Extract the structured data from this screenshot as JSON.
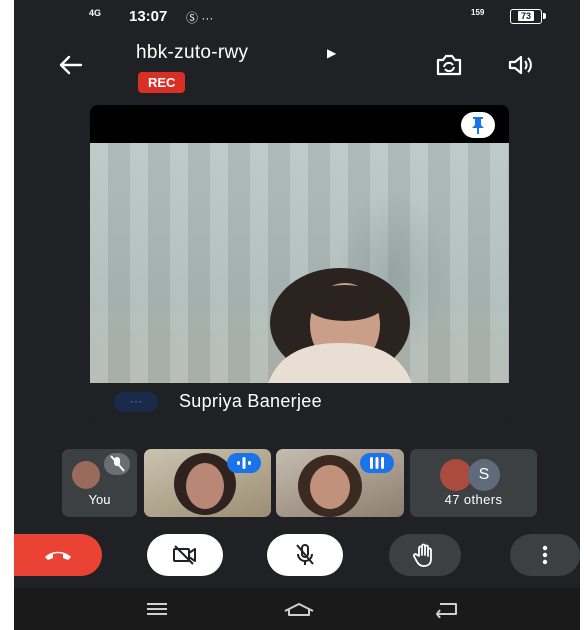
{
  "status_bar": {
    "signal": "4G",
    "time": "13:07",
    "extra_icons": "Ⓢ ···",
    "network_rate": "159",
    "battery": "73"
  },
  "header": {
    "meeting_code": "hbk-zuto-rwy",
    "recording_badge": "REC"
  },
  "main_tile": {
    "participant_name": "Supriya Banerjee",
    "chip": "···"
  },
  "filmstrip": {
    "self_label": "You",
    "others_label": "47 others",
    "others_avatar_initial": "S"
  },
  "colors": {
    "background": "#202124",
    "end_call": "#ea4335",
    "rec_badge": "#d93025",
    "active_audio": "#1a73e8"
  },
  "icons": {
    "back": "arrow-left-icon",
    "switch_camera": "switch-camera-icon",
    "speaker": "speaker-icon",
    "pin": "pin-icon",
    "end_call": "phone-hangup-icon",
    "camera_off": "videocam-off-icon",
    "mic_off": "mic-off-icon",
    "raise_hand": "hand-icon",
    "more": "more-vert-icon"
  }
}
